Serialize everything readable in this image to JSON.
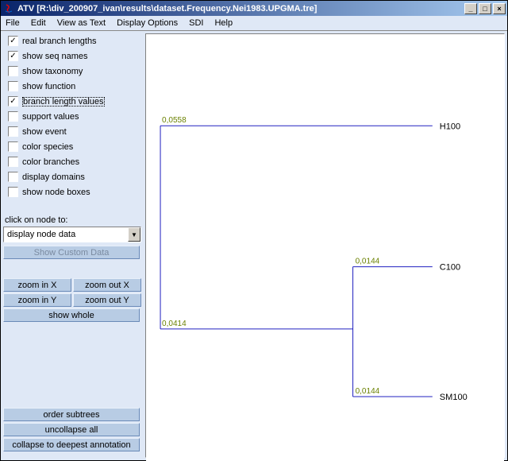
{
  "window": {
    "title": "ATV [R:\\div_200907_ivan\\results\\dataset.Frequency.Nei1983.UPGMA.tre]",
    "min_label": "_",
    "max_label": "□",
    "close_label": "×"
  },
  "menu": {
    "file": "File",
    "edit": "Edit",
    "view_as_text": "View as Text",
    "display_options": "Display Options",
    "sdi": "SDI",
    "help": "Help"
  },
  "sidebar": {
    "checks": [
      {
        "label": "real branch lengths",
        "checked": true
      },
      {
        "label": "show seq names",
        "checked": true
      },
      {
        "label": "show taxonomy",
        "checked": false
      },
      {
        "label": "show function",
        "checked": false
      },
      {
        "label": "branch length values",
        "checked": true,
        "focused": true
      },
      {
        "label": "support values",
        "checked": false
      },
      {
        "label": "show event",
        "checked": false
      },
      {
        "label": "color species",
        "checked": false
      },
      {
        "label": "color branches",
        "checked": false
      },
      {
        "label": "display domains",
        "checked": false
      },
      {
        "label": "show node boxes",
        "checked": false
      }
    ],
    "click_on_node_label": "click on node to:",
    "combo_value": "display node data",
    "show_custom_data": "Show Custom Data",
    "zoom_in_x": "zoom in X",
    "zoom_out_x": "zoom out X",
    "zoom_in_y": "zoom in Y",
    "zoom_out_y": "zoom out Y",
    "show_whole": "show whole",
    "order_subtrees": "order subtrees",
    "uncollapse_all": "uncollapse all",
    "collapse_deepest": "collapse to deepest annotation"
  },
  "tree": {
    "labels": {
      "h100": "H100",
      "c100": "C100",
      "sm100": "SM100"
    },
    "branch_lengths": {
      "root_top": "0,0558",
      "root_bottom": "0,0414",
      "c100": "0,0144",
      "sm100": "0,0144"
    }
  }
}
